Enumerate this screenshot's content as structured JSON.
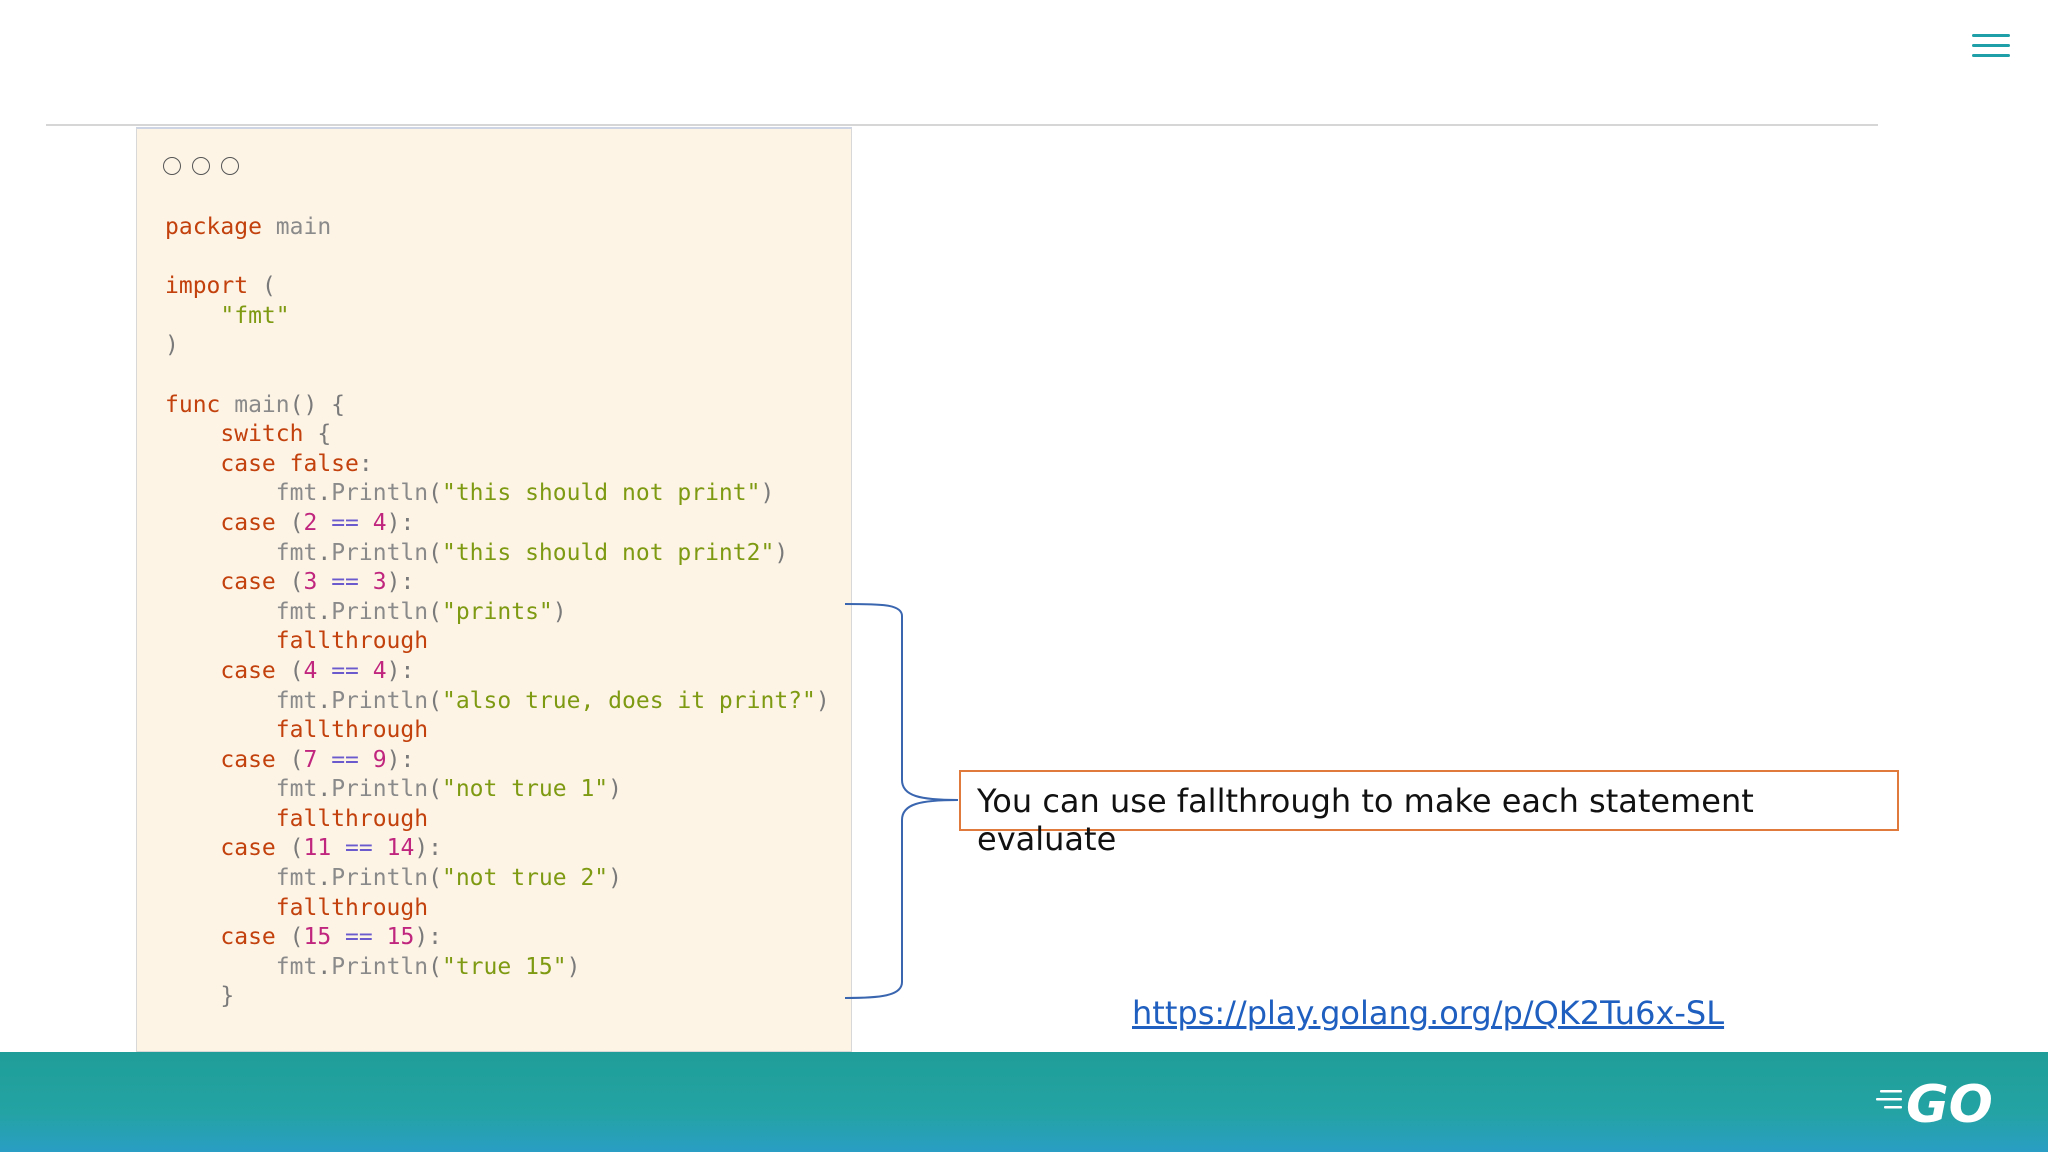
{
  "slide": {
    "callout": "You can use fallthrough to make each statement evaluate",
    "link": "https://play.golang.org/p/QK2Tu6x-SL",
    "logo_text": "GO"
  },
  "code_window": {
    "lines": [
      [
        [
          "kw",
          "package"
        ],
        [
          "id",
          " main"
        ]
      ],
      [],
      [
        [
          "kw",
          "import"
        ],
        [
          "pun",
          " ("
        ]
      ],
      [
        [
          "pun",
          "    "
        ],
        [
          "str",
          "\"fmt\""
        ]
      ],
      [
        [
          "pun",
          ")"
        ]
      ],
      [],
      [
        [
          "kw",
          "func"
        ],
        [
          "id",
          " main"
        ],
        [
          "pun",
          "() {"
        ]
      ],
      [
        [
          "pun",
          "    "
        ],
        [
          "kw",
          "switch"
        ],
        [
          "pun",
          " {"
        ]
      ],
      [
        [
          "pun",
          "    "
        ],
        [
          "kw",
          "case"
        ],
        [
          "pun",
          " "
        ],
        [
          "kw",
          "false"
        ],
        [
          "pun",
          ":"
        ]
      ],
      [
        [
          "pun",
          "        "
        ],
        [
          "id",
          "fmt"
        ],
        [
          "pun",
          "."
        ],
        [
          "id",
          "Println"
        ],
        [
          "pun",
          "("
        ],
        [
          "str",
          "\"this should not print\""
        ],
        [
          "pun",
          ")"
        ]
      ],
      [
        [
          "pun",
          "    "
        ],
        [
          "kw",
          "case"
        ],
        [
          "pun",
          " ("
        ],
        [
          "num",
          "2"
        ],
        [
          "pun",
          " "
        ],
        [
          "op",
          "=="
        ],
        [
          "pun",
          " "
        ],
        [
          "num",
          "4"
        ],
        [
          "pun",
          "):"
        ]
      ],
      [
        [
          "pun",
          "        "
        ],
        [
          "id",
          "fmt"
        ],
        [
          "pun",
          "."
        ],
        [
          "id",
          "Println"
        ],
        [
          "pun",
          "("
        ],
        [
          "str",
          "\"this should not print2\""
        ],
        [
          "pun",
          ")"
        ]
      ],
      [
        [
          "pun",
          "    "
        ],
        [
          "kw",
          "case"
        ],
        [
          "pun",
          " ("
        ],
        [
          "num",
          "3"
        ],
        [
          "pun",
          " "
        ],
        [
          "op",
          "=="
        ],
        [
          "pun",
          " "
        ],
        [
          "num",
          "3"
        ],
        [
          "pun",
          "):"
        ]
      ],
      [
        [
          "pun",
          "        "
        ],
        [
          "id",
          "fmt"
        ],
        [
          "pun",
          "."
        ],
        [
          "id",
          "Println"
        ],
        [
          "pun",
          "("
        ],
        [
          "str",
          "\"prints\""
        ],
        [
          "pun",
          ")"
        ]
      ],
      [
        [
          "pun",
          "        "
        ],
        [
          "kw",
          "fallthrough"
        ]
      ],
      [
        [
          "pun",
          "    "
        ],
        [
          "kw",
          "case"
        ],
        [
          "pun",
          " ("
        ],
        [
          "num",
          "4"
        ],
        [
          "pun",
          " "
        ],
        [
          "op",
          "=="
        ],
        [
          "pun",
          " "
        ],
        [
          "num",
          "4"
        ],
        [
          "pun",
          "):"
        ]
      ],
      [
        [
          "pun",
          "        "
        ],
        [
          "id",
          "fmt"
        ],
        [
          "pun",
          "."
        ],
        [
          "id",
          "Println"
        ],
        [
          "pun",
          "("
        ],
        [
          "str",
          "\"also true, does it print?\""
        ],
        [
          "pun",
          ")"
        ]
      ],
      [
        [
          "pun",
          "        "
        ],
        [
          "kw",
          "fallthrough"
        ]
      ],
      [
        [
          "pun",
          "    "
        ],
        [
          "kw",
          "case"
        ],
        [
          "pun",
          " ("
        ],
        [
          "num",
          "7"
        ],
        [
          "pun",
          " "
        ],
        [
          "op",
          "=="
        ],
        [
          "pun",
          " "
        ],
        [
          "num",
          "9"
        ],
        [
          "pun",
          "):"
        ]
      ],
      [
        [
          "pun",
          "        "
        ],
        [
          "id",
          "fmt"
        ],
        [
          "pun",
          "."
        ],
        [
          "id",
          "Println"
        ],
        [
          "pun",
          "("
        ],
        [
          "str",
          "\"not true 1\""
        ],
        [
          "pun",
          ")"
        ]
      ],
      [
        [
          "pun",
          "        "
        ],
        [
          "kw",
          "fallthrough"
        ]
      ],
      [
        [
          "pun",
          "    "
        ],
        [
          "kw",
          "case"
        ],
        [
          "pun",
          " ("
        ],
        [
          "num",
          "11"
        ],
        [
          "pun",
          " "
        ],
        [
          "op",
          "=="
        ],
        [
          "pun",
          " "
        ],
        [
          "num",
          "14"
        ],
        [
          "pun",
          "):"
        ]
      ],
      [
        [
          "pun",
          "        "
        ],
        [
          "id",
          "fmt"
        ],
        [
          "pun",
          "."
        ],
        [
          "id",
          "Println"
        ],
        [
          "pun",
          "("
        ],
        [
          "str",
          "\"not true 2\""
        ],
        [
          "pun",
          ")"
        ]
      ],
      [
        [
          "pun",
          "        "
        ],
        [
          "kw",
          "fallthrough"
        ]
      ],
      [
        [
          "pun",
          "    "
        ],
        [
          "kw",
          "case"
        ],
        [
          "pun",
          " ("
        ],
        [
          "num",
          "15"
        ],
        [
          "pun",
          " "
        ],
        [
          "op",
          "=="
        ],
        [
          "pun",
          " "
        ],
        [
          "num",
          "15"
        ],
        [
          "pun",
          "):"
        ]
      ],
      [
        [
          "pun",
          "        "
        ],
        [
          "id",
          "fmt"
        ],
        [
          "pun",
          "."
        ],
        [
          "id",
          "Println"
        ],
        [
          "pun",
          "("
        ],
        [
          "str",
          "\"true 15\""
        ],
        [
          "pun",
          ")"
        ]
      ],
      [
        [
          "pun",
          "    }"
        ]
      ]
    ]
  },
  "colors": {
    "accent": "#1fa0a8",
    "footer": "#23a3a3",
    "callout_border": "#e07a3c",
    "link": "#1f5fbf",
    "code_bg": "#fdf4e6",
    "brace": "#3a66b0"
  },
  "icons": [
    "hamburger-menu-icon",
    "window-control-dot",
    "go-logo"
  ]
}
